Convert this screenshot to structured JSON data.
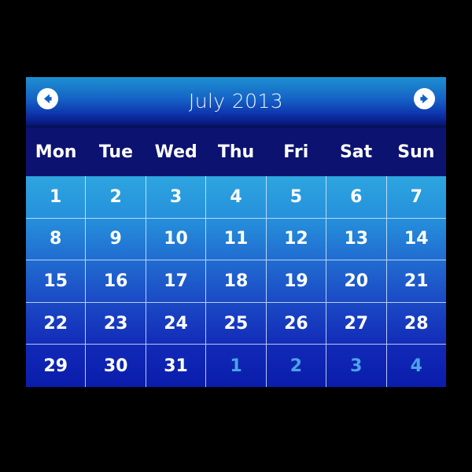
{
  "widget": {
    "name": "monthly-calendar",
    "title": "July 2013",
    "month": "July",
    "year": "2013"
  },
  "header": {
    "title": "July 2013",
    "prev_label": "←",
    "next_label": "→",
    "prev_icon": "arrow-left-circle-icon",
    "next_icon": "arrow-right-circle-icon",
    "gradient_top": "#1f8fd4",
    "gradient_bottom": "#050d4e"
  },
  "weekdays": [
    {
      "label": "Mon"
    },
    {
      "label": "Tue"
    },
    {
      "label": "Wed"
    },
    {
      "label": "Thu"
    },
    {
      "label": "Fri"
    },
    {
      "label": "Sat"
    },
    {
      "label": "Sun"
    }
  ],
  "weeks": [
    [
      {
        "day": "1",
        "current_month": true
      },
      {
        "day": "2",
        "current_month": true
      },
      {
        "day": "3",
        "current_month": true
      },
      {
        "day": "4",
        "current_month": true
      },
      {
        "day": "5",
        "current_month": true
      },
      {
        "day": "6",
        "current_month": true
      },
      {
        "day": "7",
        "current_month": true
      }
    ],
    [
      {
        "day": "8",
        "current_month": true
      },
      {
        "day": "9",
        "current_month": true
      },
      {
        "day": "10",
        "current_month": true
      },
      {
        "day": "11",
        "current_month": true
      },
      {
        "day": "12",
        "current_month": true
      },
      {
        "day": "13",
        "current_month": true
      },
      {
        "day": "14",
        "current_month": true
      }
    ],
    [
      {
        "day": "15",
        "current_month": true
      },
      {
        "day": "16",
        "current_month": true
      },
      {
        "day": "17",
        "current_month": true
      },
      {
        "day": "18",
        "current_month": true
      },
      {
        "day": "19",
        "current_month": true
      },
      {
        "day": "20",
        "current_month": true
      },
      {
        "day": "21",
        "current_month": true
      }
    ],
    [
      {
        "day": "22",
        "current_month": true
      },
      {
        "day": "23",
        "current_month": true
      },
      {
        "day": "24",
        "current_month": true
      },
      {
        "day": "25",
        "current_month": true
      },
      {
        "day": "26",
        "current_month": true
      },
      {
        "day": "27",
        "current_month": true
      },
      {
        "day": "28",
        "current_month": true
      }
    ],
    [
      {
        "day": "29",
        "current_month": true
      },
      {
        "day": "30",
        "current_month": true
      },
      {
        "day": "31",
        "current_month": true
      },
      {
        "day": "1",
        "current_month": false
      },
      {
        "day": "2",
        "current_month": false
      },
      {
        "day": "3",
        "current_month": false
      },
      {
        "day": "4",
        "current_month": false
      }
    ]
  ],
  "colors": {
    "page_background": "#000000",
    "weekday_row_background": "#0b1270",
    "grid_top": "#2ea5e0",
    "grid_bottom": "#0a1cab",
    "day_text": "#ffffff",
    "other_month_text": "#4ba3e8",
    "grid_line": "#d2e8fa",
    "nav_circle": "#ffffff"
  }
}
